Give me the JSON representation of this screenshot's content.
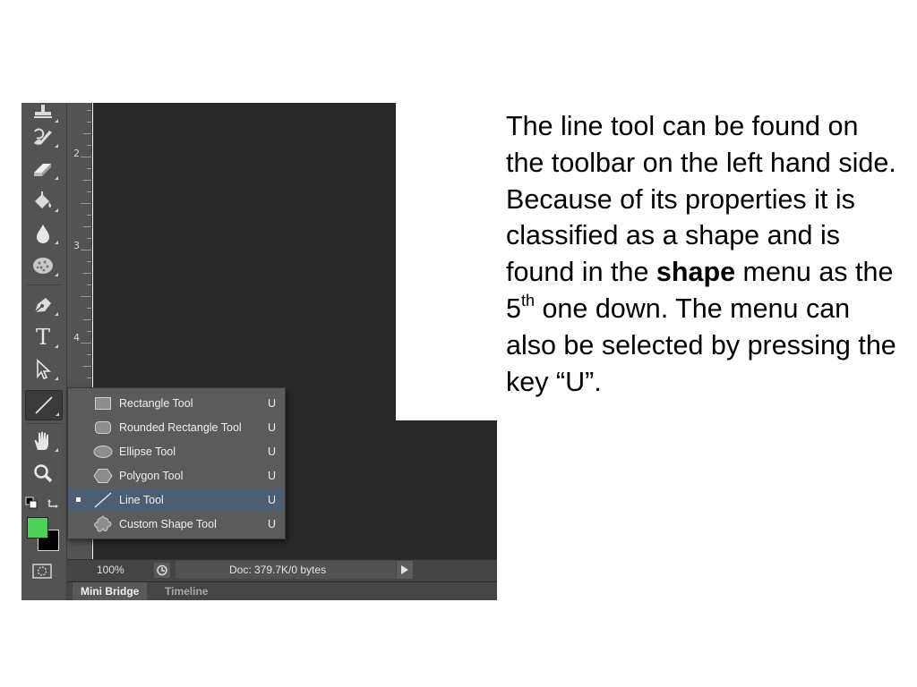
{
  "photoshop": {
    "ruler_numbers": [
      "2",
      "3",
      "4"
    ],
    "tools": [
      {
        "name": "stamp-icon"
      },
      {
        "name": "history-brush-icon"
      },
      {
        "name": "eraser-icon"
      },
      {
        "name": "paint-bucket-icon"
      },
      {
        "name": "blur-drop-icon"
      },
      {
        "name": "sponge-icon"
      },
      {
        "name": "pen-icon"
      },
      {
        "name": "type-icon",
        "glyph": "T"
      },
      {
        "name": "path-selection-icon"
      },
      {
        "name": "line-tool-icon"
      },
      {
        "name": "hand-icon"
      },
      {
        "name": "zoom-icon"
      }
    ],
    "flyout_menu": [
      {
        "label": "Rectangle Tool",
        "shortcut": "U",
        "icon": "rectangle-icon",
        "selected": false
      },
      {
        "label": "Rounded Rectangle Tool",
        "shortcut": "U",
        "icon": "rounded-rectangle-icon",
        "selected": false
      },
      {
        "label": "Ellipse Tool",
        "shortcut": "U",
        "icon": "ellipse-icon",
        "selected": false
      },
      {
        "label": "Polygon Tool",
        "shortcut": "U",
        "icon": "polygon-icon",
        "selected": false
      },
      {
        "label": "Line Tool",
        "shortcut": "U",
        "icon": "line-icon",
        "selected": true
      },
      {
        "label": "Custom Shape Tool",
        "shortcut": "U",
        "icon": "custom-shape-icon",
        "selected": false
      }
    ],
    "colors": {
      "foreground": "#4fd05b",
      "background": "#000000",
      "canvas": "#282828",
      "toolbar": "#535353",
      "menu_highlight": "#4b5e74"
    },
    "status_bar": {
      "zoom": "100%",
      "doc_info": "Doc: 379.7K/0 bytes"
    },
    "panel_tabs": [
      "Mini Bridge",
      "Timeline"
    ]
  },
  "slide": {
    "para_part1": "The line tool can be found on the toolbar on the left hand side. Because of its properties it is classified as a shape and is found in the",
    "bold_word": "shape",
    "para_part2": "menu as the 5",
    "superscript": "th",
    "para_part3": "one down. The menu can also be selected by pressing the key “U”."
  }
}
